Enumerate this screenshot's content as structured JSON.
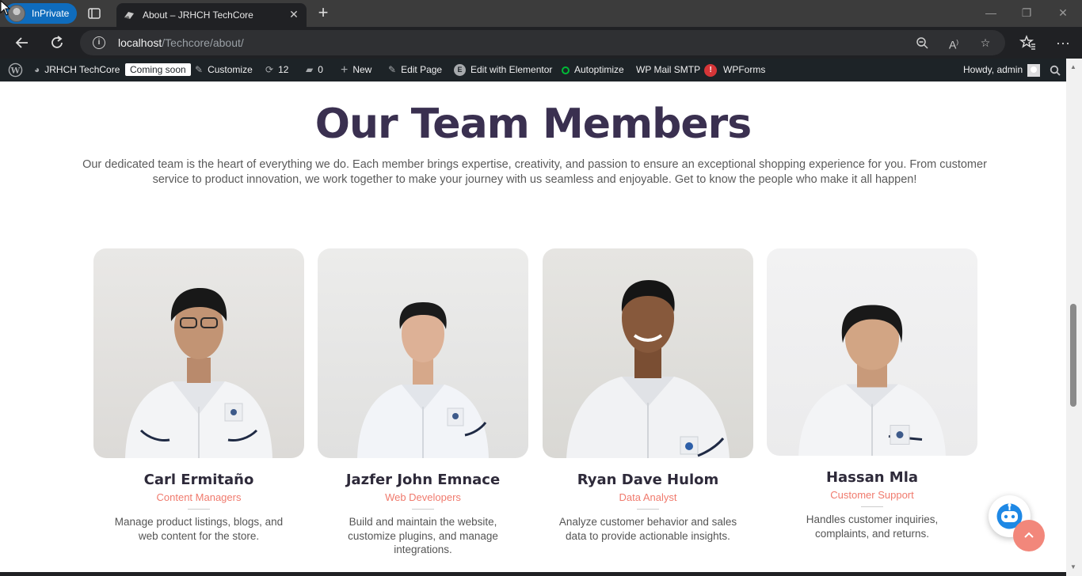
{
  "browser": {
    "inprivate_label": "InPrivate",
    "tab_title": "About – JRHCH TechCore",
    "url_host": "localhost",
    "url_path": "/Techcore/about/"
  },
  "adminbar": {
    "site_name": "JRHCH TechCore",
    "coming_soon": "Coming soon",
    "customize": "Customize",
    "updates_count": "12",
    "comments_count": "0",
    "new": "New",
    "edit_page": "Edit Page",
    "edit_elementor": "Edit with Elementor",
    "autoptimize": "Autoptimize",
    "wp_mail_smtp": "WP Mail SMTP",
    "smtp_alert": "!",
    "wpforms": "WPForms",
    "howdy": "Howdy, admin"
  },
  "section": {
    "title": "Our Team Members",
    "intro": "Our dedicated team is the heart of everything we do. Each member brings expertise, creativity, and passion to ensure an exceptional shopping experience for you. From customer service to product innovation, we work together to make your journey with us seamless and enjoyable. Get to know the people who make it all happen!"
  },
  "team": [
    {
      "name": "Carl Ermitaño",
      "role": "Content Managers",
      "desc": "Manage product listings, blogs, and web content for the store."
    },
    {
      "name": "Jazfer John Emnace",
      "role": "Web Developers",
      "desc": "Build and maintain the website, customize plugins, and manage integrations."
    },
    {
      "name": "Ryan Dave Hulom",
      "role": "Data Analyst",
      "desc": "Analyze customer behavior and sales data to provide actionable insights."
    },
    {
      "name": "Hassan Mla",
      "role": "Customer Support",
      "desc": "Handles customer inquiries, complaints, and returns."
    }
  ],
  "colors": {
    "heading": "#3a3050",
    "role_accent": "#f07a6d",
    "to_top": "#f2877b",
    "adminbar": "#1d2327"
  },
  "icons": {
    "chatbot": "robot-icon",
    "to_top": "chevron-up-icon"
  }
}
